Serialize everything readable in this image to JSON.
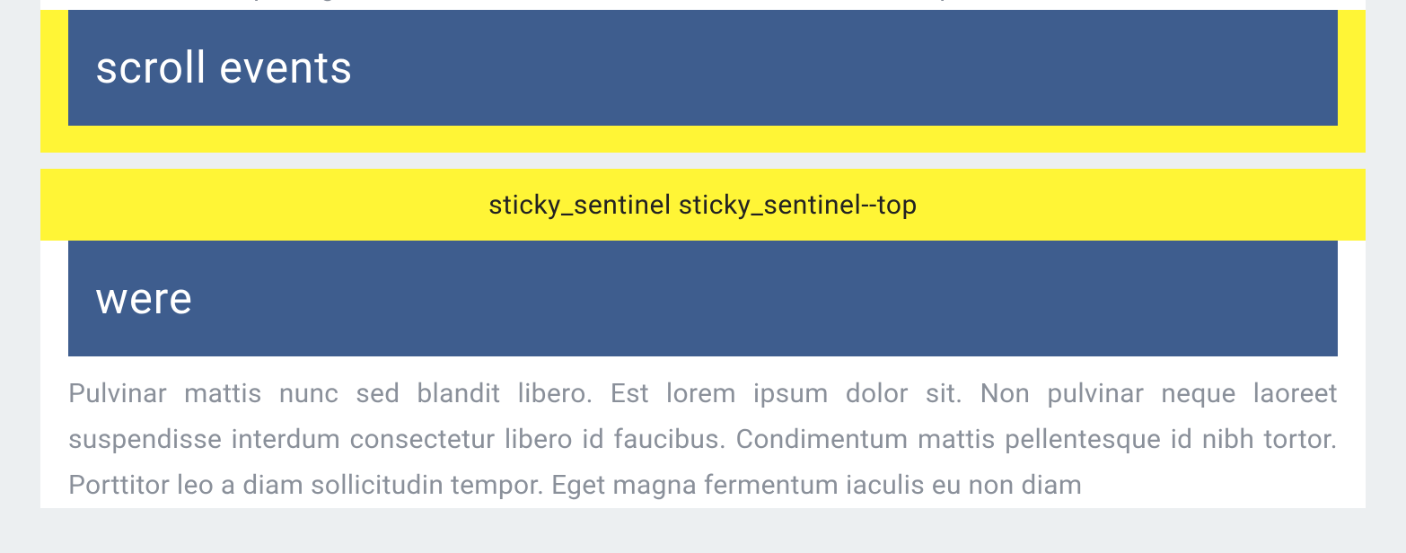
{
  "sections": {
    "first": {
      "partial_paragraph": "sem viverra aliquet eget. Dui accumsan sit amet nulla facilisi morbi tempus iaculis. Proin libero",
      "header": "scroll events"
    },
    "second": {
      "sentinel_label": "sticky_sentinel sticky_sentinel--top",
      "header": "were",
      "paragraph": "Pulvinar mattis nunc sed blandit libero. Est lorem ipsum dolor sit. Non pulvinar neque laoreet suspendisse interdum consectetur libero id faucibus. Condimentum mattis pellentesque id nibh tortor. Porttitor leo a diam sollicitudin tempor. Eget magna fermentum iaculis eu non diam"
    }
  }
}
